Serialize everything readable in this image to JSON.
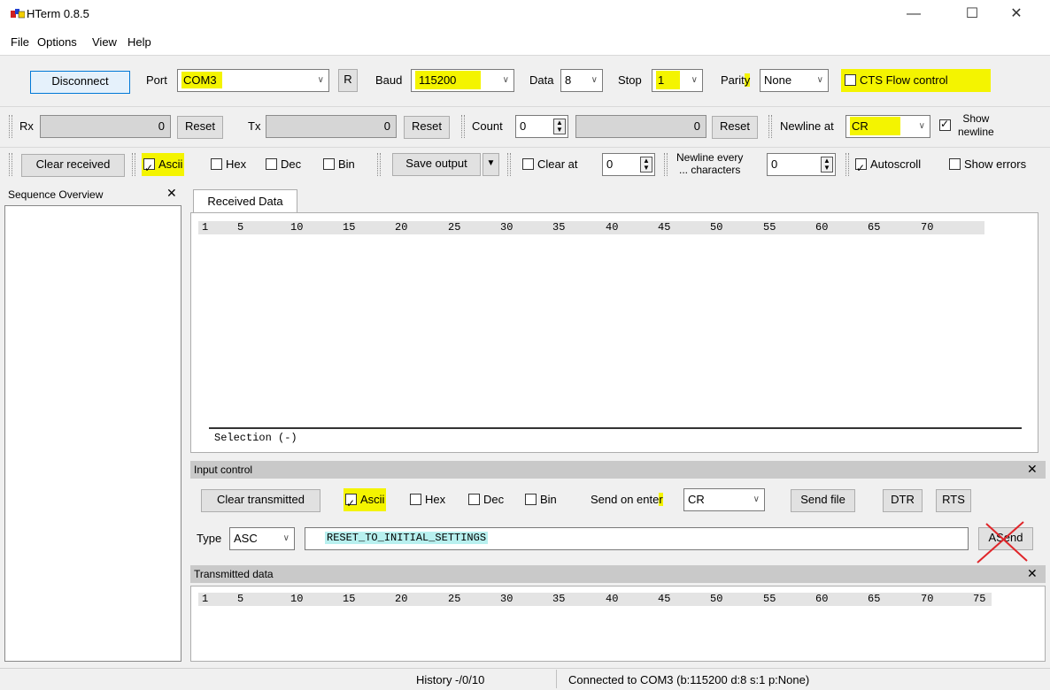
{
  "window": {
    "title": "HTerm 0.8.5",
    "minimize": "—",
    "maximize": "☐",
    "close": "✕"
  },
  "menu": [
    "File",
    "Options",
    "View",
    "Help"
  ],
  "connection": {
    "disconnect_label": "Disconnect",
    "port_label": "Port",
    "port_value": "COM3",
    "rescan_label": "R",
    "baud_label": "Baud",
    "baud_value": "115200",
    "data_label": "Data",
    "data_value": "8",
    "stop_label": "Stop",
    "stop_value": "1",
    "parity_label": "Parity",
    "parity_value": "None",
    "cts_label": "CTS Flow control"
  },
  "counters": {
    "rx_label": "Rx",
    "rx_value": "0",
    "rx_reset": "Reset",
    "tx_label": "Tx",
    "tx_value": "0",
    "tx_reset": "Reset",
    "count_label": "Count",
    "count_value": "0",
    "count_field": "0",
    "count_reset": "Reset",
    "newline_at_label": "Newline at",
    "newline_at_value": "CR",
    "show_newline_label": "Show newline",
    "show_newline_1": "Show",
    "show_newline_2": "newline"
  },
  "receive_options": {
    "clear_received": "Clear received",
    "ascii": "Ascii",
    "hex": "Hex",
    "dec": "Dec",
    "bin": "Bin",
    "save_output": "Save output",
    "clear_at": "Clear at",
    "clear_at_value": "0",
    "newline_every_1": "Newline every",
    "newline_every_2": "... characters",
    "newline_every_value": "0",
    "autoscroll": "Autoscroll",
    "show_errors": "Show errors"
  },
  "sequence_overview": {
    "title": "Sequence Overview",
    "close": "✕"
  },
  "received": {
    "tab": "Received Data",
    "ruler": [
      "1",
      "5",
      "10",
      "15",
      "20",
      "25",
      "30",
      "35",
      "40",
      "45",
      "50",
      "55",
      "60",
      "65",
      "70"
    ],
    "selection": "Selection (-)"
  },
  "input_control": {
    "title": "Input control",
    "close": "✕",
    "clear_transmitted": "Clear transmitted",
    "ascii": "Ascii",
    "hex": "Hex",
    "dec": "Dec",
    "bin": "Bin",
    "send_on_enter_label": "Send on enter",
    "send_on_enter_value": "CR",
    "send_file": "Send file",
    "dtr": "DTR",
    "rts": "RTS",
    "type_label": "Type",
    "type_value": "ASC",
    "input_value": "RESET_TO_INITIAL_SETTINGS",
    "send_label": "ASend"
  },
  "transmitted": {
    "title": "Transmitted data",
    "close": "✕",
    "ruler": [
      "1",
      "5",
      "10",
      "15",
      "20",
      "25",
      "30",
      "35",
      "40",
      "45",
      "50",
      "55",
      "60",
      "65",
      "70",
      "75"
    ]
  },
  "statusbar": {
    "history": "History -/0/10",
    "connection": "Connected to COM3 (b:115200 d:8 s:1 p:None)"
  },
  "colors": {
    "highlight": "#f4f400",
    "annotation_cross": "#e0262a",
    "input_selection": "#b8f0ef"
  }
}
